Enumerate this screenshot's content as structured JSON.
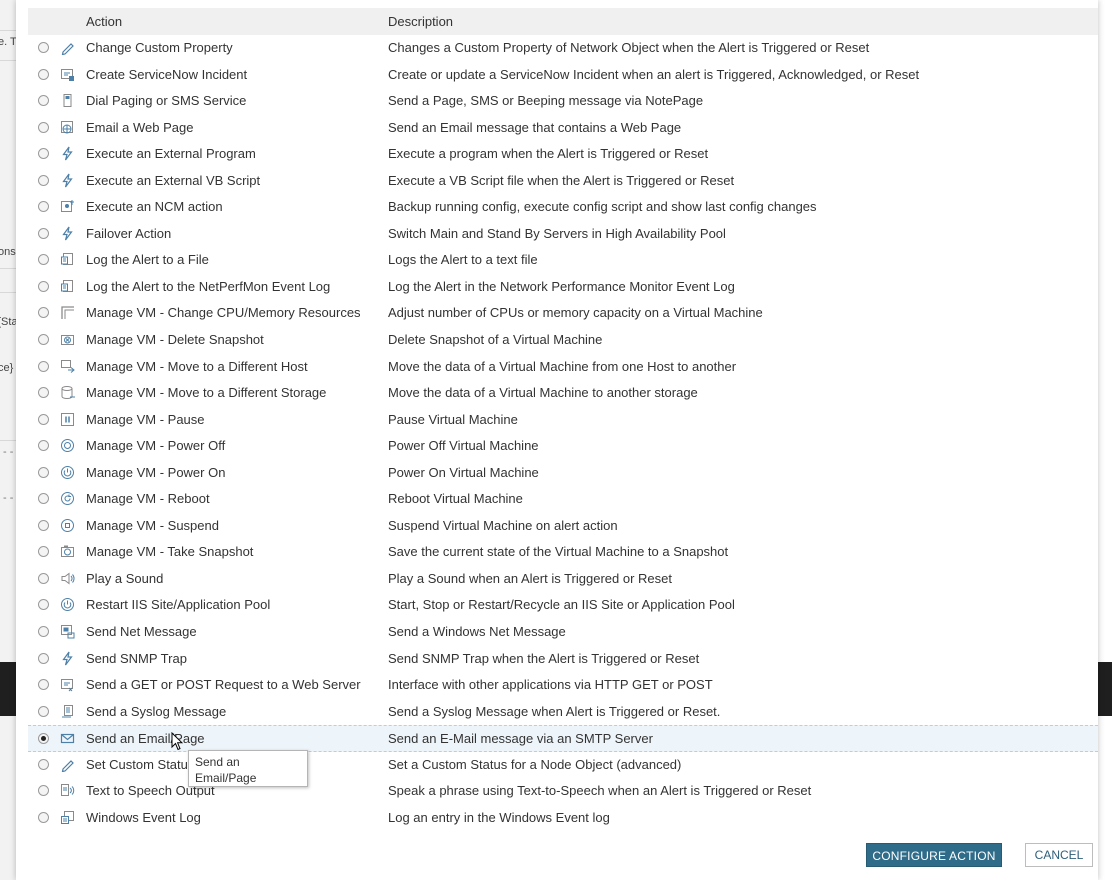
{
  "background": {
    "fragments": [
      "e. T",
      "ons",
      "[Sta",
      "ce}"
    ]
  },
  "table": {
    "header": {
      "action": "Action",
      "description": "Description"
    },
    "rows": [
      {
        "icon": "pencil-icon",
        "action": "Change Custom Property",
        "description": "Changes a Custom Property of Network Object when the Alert is Triggered or Reset",
        "selected": false
      },
      {
        "icon": "ticket-icon",
        "action": "Create ServiceNow Incident",
        "description": "Create or update a ServiceNow Incident when an alert is Triggered, Acknowledged, or Reset",
        "selected": false
      },
      {
        "icon": "pager-icon",
        "action": "Dial Paging or SMS Service",
        "description": "Send a Page, SMS or Beeping message via NotePage",
        "selected": false
      },
      {
        "icon": "web-page-icon",
        "action": "Email a Web Page",
        "description": "Send an Email message that contains a Web Page",
        "selected": false
      },
      {
        "icon": "lightning-icon",
        "action": "Execute an External Program",
        "description": "Execute a program when the Alert is Triggered or Reset",
        "selected": false
      },
      {
        "icon": "lightning-icon",
        "action": "Execute an External VB Script",
        "description": "Execute a VB Script file when the Alert is Triggered or Reset",
        "selected": false
      },
      {
        "icon": "config-icon",
        "action": "Execute an NCM action",
        "description": "Backup running config, execute config script and show last config changes",
        "selected": false
      },
      {
        "icon": "lightning-icon",
        "action": "Failover Action",
        "description": "Switch Main and Stand By Servers in High Availability Pool",
        "selected": false
      },
      {
        "icon": "log-file-icon",
        "action": "Log the Alert to a File",
        "description": "Logs the Alert to a text file",
        "selected": false
      },
      {
        "icon": "log-file-icon",
        "action": "Log the Alert to the NetPerfMon Event Log",
        "description": "Log the Alert in the Network Performance Monitor Event Log",
        "selected": false
      },
      {
        "icon": "resize-icon",
        "action": "Manage VM - Change CPU/Memory Resources",
        "description": "Adjust number of CPUs or memory capacity on a Virtual Machine",
        "selected": false
      },
      {
        "icon": "delete-snapshot-icon",
        "action": "Manage VM - Delete Snapshot",
        "description": "Delete Snapshot of a Virtual Machine",
        "selected": false
      },
      {
        "icon": "move-host-icon",
        "action": "Manage VM - Move to a Different Host",
        "description": "Move the data of a Virtual Machine from one Host to another",
        "selected": false
      },
      {
        "icon": "storage-icon",
        "action": "Manage VM - Move to a Different Storage",
        "description": "Move the data of a Virtual Machine to another storage",
        "selected": false
      },
      {
        "icon": "pause-icon",
        "action": "Manage VM - Pause",
        "description": "Pause Virtual Machine",
        "selected": false
      },
      {
        "icon": "power-off-icon",
        "action": "Manage VM - Power Off",
        "description": "Power Off Virtual Machine",
        "selected": false
      },
      {
        "icon": "power-on-icon",
        "action": "Manage VM - Power On",
        "description": "Power On Virtual Machine",
        "selected": false
      },
      {
        "icon": "reboot-icon",
        "action": "Manage VM - Reboot",
        "description": "Reboot Virtual Machine",
        "selected": false
      },
      {
        "icon": "suspend-icon",
        "action": "Manage VM - Suspend",
        "description": "Suspend Virtual Machine on alert action",
        "selected": false
      },
      {
        "icon": "camera-icon",
        "action": "Manage VM - Take Snapshot",
        "description": "Save the current state of the Virtual Machine to a Snapshot",
        "selected": false
      },
      {
        "icon": "speaker-icon",
        "action": "Play a Sound",
        "description": "Play a Sound when an Alert is Triggered or Reset",
        "selected": false
      },
      {
        "icon": "power-on-icon",
        "action": "Restart IIS Site/Application Pool",
        "description": "Start, Stop or Restart/Recycle an IIS Site or Application Pool",
        "selected": false
      },
      {
        "icon": "net-message-icon",
        "action": "Send Net Message",
        "description": "Send a Windows Net Message",
        "selected": false
      },
      {
        "icon": "lightning-icon",
        "action": "Send SNMP Trap",
        "description": "Send SNMP Trap when the Alert is Triggered or Reset",
        "selected": false
      },
      {
        "icon": "web-request-icon",
        "action": "Send a GET or POST Request to a Web Server",
        "description": "Interface with other applications via HTTP GET or POST",
        "selected": false
      },
      {
        "icon": "syslog-icon",
        "action": "Send a Syslog Message",
        "description": "Send a Syslog Message when Alert is Triggered or Reset.",
        "selected": false
      },
      {
        "icon": "envelope-icon",
        "action": "Send an Email/Page",
        "description": "Send an E-Mail message via an SMTP Server",
        "selected": true
      },
      {
        "icon": "pencil-icon",
        "action": "Set Custom Status",
        "description": "Set a Custom Status for a Node Object (advanced)",
        "selected": false
      },
      {
        "icon": "text-to-speech-icon",
        "action": "Text to Speech Output",
        "description": "Speak a phrase using Text-to-Speech when an Alert is Triggered or Reset",
        "selected": false
      },
      {
        "icon": "event-log-icon",
        "action": "Windows Event Log",
        "description": "Log an entry in the Windows Event log",
        "selected": false
      }
    ]
  },
  "tooltip": {
    "line1": "Send an",
    "line2": "Email/Page"
  },
  "buttons": {
    "configure": "CONFIGURE ACTION",
    "cancel": "CANCEL"
  },
  "colors": {
    "primary": "#2f6c8a",
    "selected_row": "#eef5fa",
    "icon": "#4d80a8"
  }
}
